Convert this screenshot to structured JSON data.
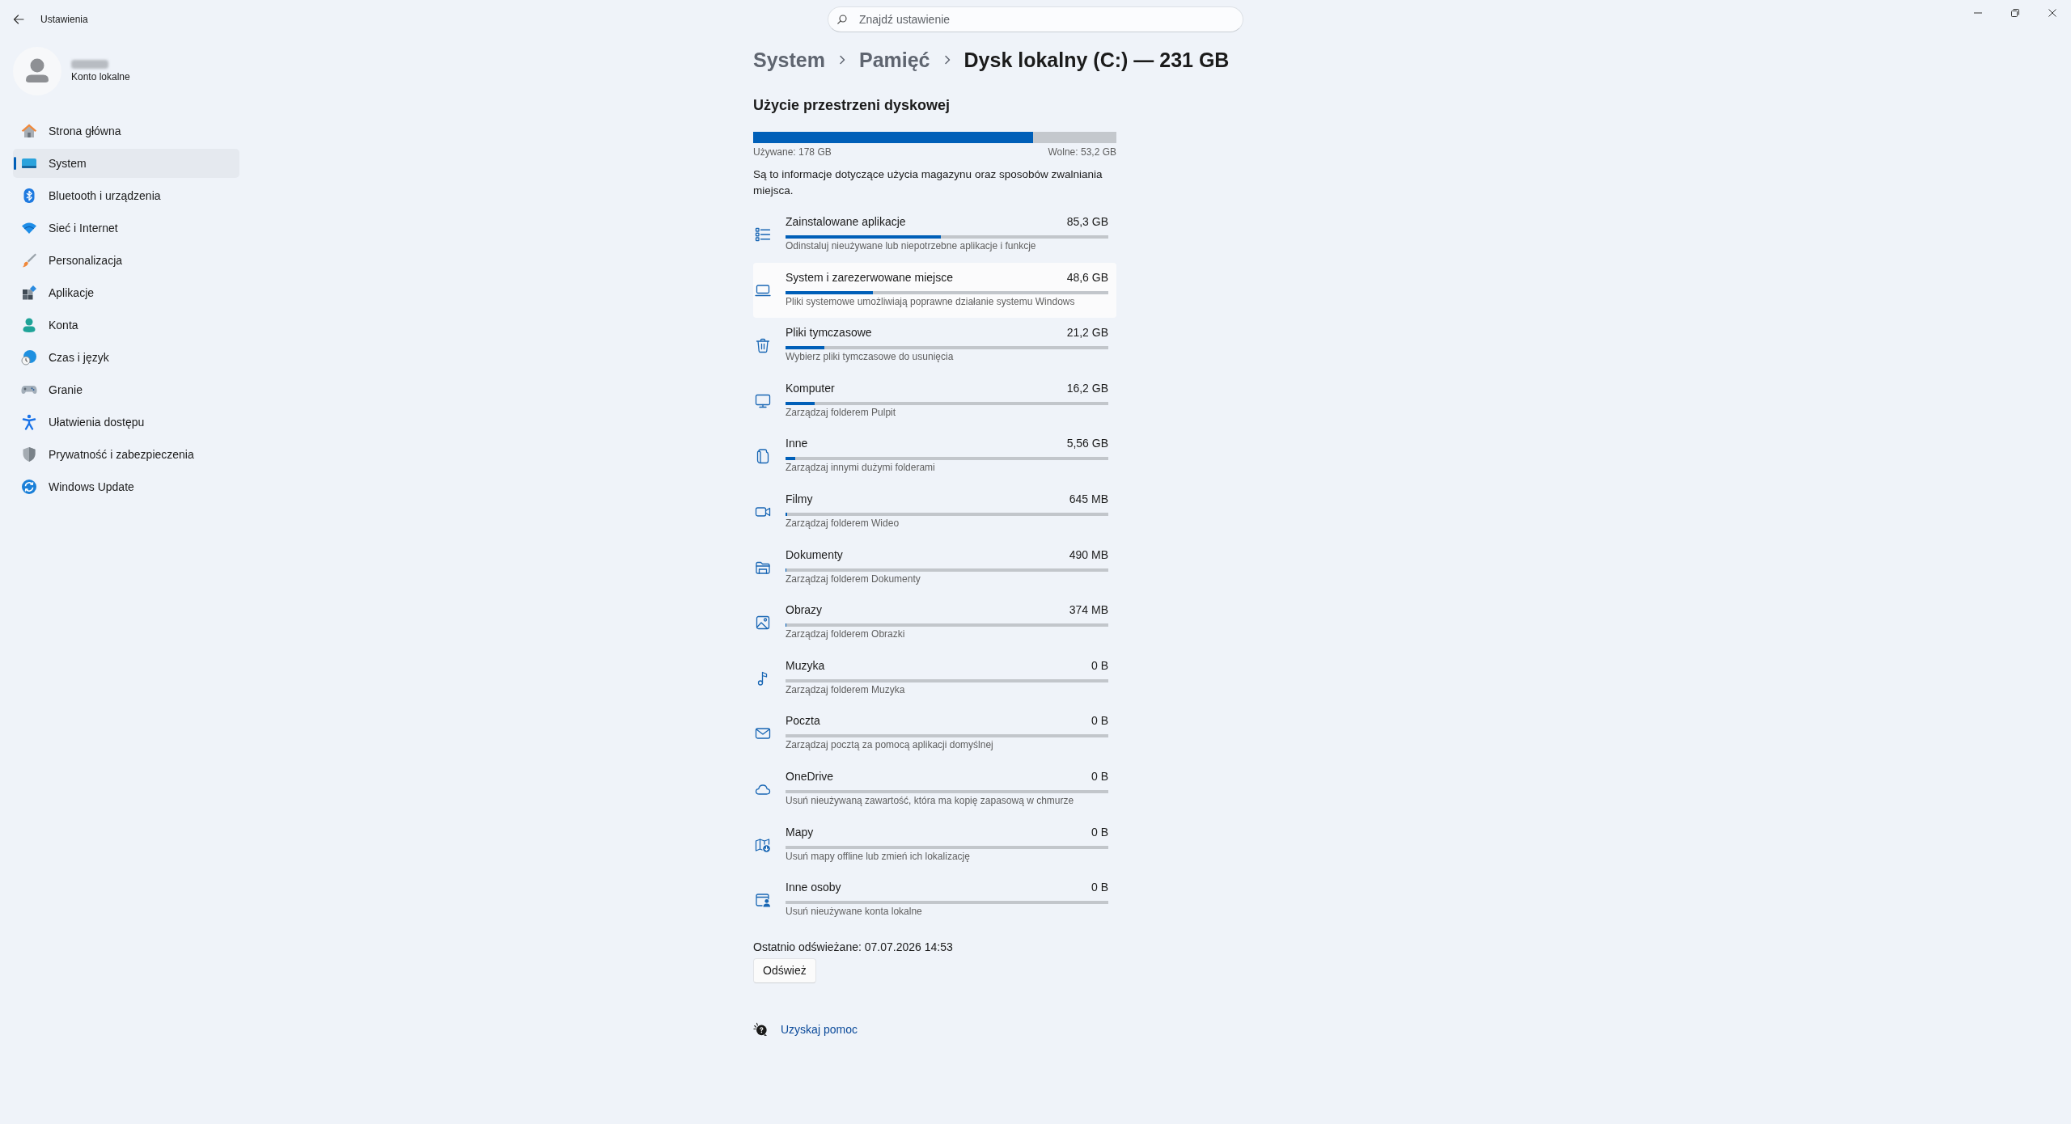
{
  "window": {
    "title": "Ustawienia"
  },
  "search": {
    "placeholder": "Znajdź ustawienie"
  },
  "account": {
    "subtitle": "Konto lokalne"
  },
  "sidebar": {
    "items": [
      {
        "label": "Strona główna",
        "selected": false
      },
      {
        "label": "System",
        "selected": true
      },
      {
        "label": "Bluetooth i urządzenia",
        "selected": false
      },
      {
        "label": "Sieć i Internet",
        "selected": false
      },
      {
        "label": "Personalizacja",
        "selected": false
      },
      {
        "label": "Aplikacje",
        "selected": false
      },
      {
        "label": "Konta",
        "selected": false
      },
      {
        "label": "Czas i język",
        "selected": false
      },
      {
        "label": "Granie",
        "selected": false
      },
      {
        "label": "Ułatwienia dostępu",
        "selected": false
      },
      {
        "label": "Prywatność i zabezpieczenia",
        "selected": false
      },
      {
        "label": "Windows Update",
        "selected": false
      }
    ]
  },
  "breadcrumb": [
    {
      "label": "System",
      "current": false
    },
    {
      "label": "Pamięć",
      "current": false
    },
    {
      "label": "Dysk lokalny (C:) — 231 GB",
      "current": true
    }
  ],
  "section_title": "Użycie przestrzeni dyskowej",
  "disk": {
    "level": 0.77,
    "used": "Używane: 178 GB",
    "free": "Wolne: 53,2 GB"
  },
  "description": "Są to informacje dotyczące użycia magazynu oraz sposobów zwalniania miejsca.",
  "categories": [
    {
      "title": "Zainstalowane aplikacje",
      "size": "85,3 GB",
      "subtitle": "Odinstaluj nieużywane lub niepotrzebne aplikacje i funkcje",
      "level": 0.48,
      "highlighted": false
    },
    {
      "title": "System i zarezerwowane miejsce",
      "size": "48,6 GB",
      "subtitle": "Pliki systemowe umożliwiają poprawne działanie systemu Windows",
      "level": 0.27,
      "highlighted": true
    },
    {
      "title": "Pliki tymczasowe",
      "size": "21,2 GB",
      "subtitle": "Wybierz pliki tymczasowe do usunięcia",
      "level": 0.12,
      "highlighted": false
    },
    {
      "title": "Komputer",
      "size": "16,2 GB",
      "subtitle": "Zarządzaj folderem Pulpit",
      "level": 0.09,
      "highlighted": false
    },
    {
      "title": "Inne",
      "size": "5,56 GB",
      "subtitle": "Zarządzaj innymi dużymi folderami",
      "level": 0.03,
      "highlighted": false
    },
    {
      "title": "Filmy",
      "size": "645 MB",
      "subtitle": "Zarządzaj folderem Wideo",
      "level": 0.004,
      "highlighted": false
    },
    {
      "title": "Dokumenty",
      "size": "490 MB",
      "subtitle": "Zarządzaj folderem Dokumenty",
      "level": 0.003,
      "highlighted": false
    },
    {
      "title": "Obrazy",
      "size": "374 MB",
      "subtitle": "Zarządzaj folderem Obrazki",
      "level": 0.002,
      "highlighted": false
    },
    {
      "title": "Muzyka",
      "size": "0 B",
      "subtitle": "Zarządzaj folderem Muzyka",
      "highlighted": false
    },
    {
      "title": "Poczta",
      "size": "0 B",
      "subtitle": "Zarządzaj pocztą za pomocą aplikacji domyślnej",
      "highlighted": false
    },
    {
      "title": "OneDrive",
      "size": "0 B",
      "subtitle": "Usuń nieużywaną zawartość, która ma kopię zapasową w chmurze",
      "highlighted": false
    },
    {
      "title": "Mapy",
      "size": "0 B",
      "subtitle": "Usuń mapy offline lub zmień ich lokalizację",
      "highlighted": false
    },
    {
      "title": "Inne osoby",
      "size": "0 B",
      "subtitle": "Usuń nieużywane konta lokalne",
      "highlighted": false
    }
  ],
  "last_refreshed": "Ostatnio odświeżane: 07.07.2026 14:53",
  "refresh_button": "Odśwież",
  "help_link": "Uzyskaj pomoc"
}
